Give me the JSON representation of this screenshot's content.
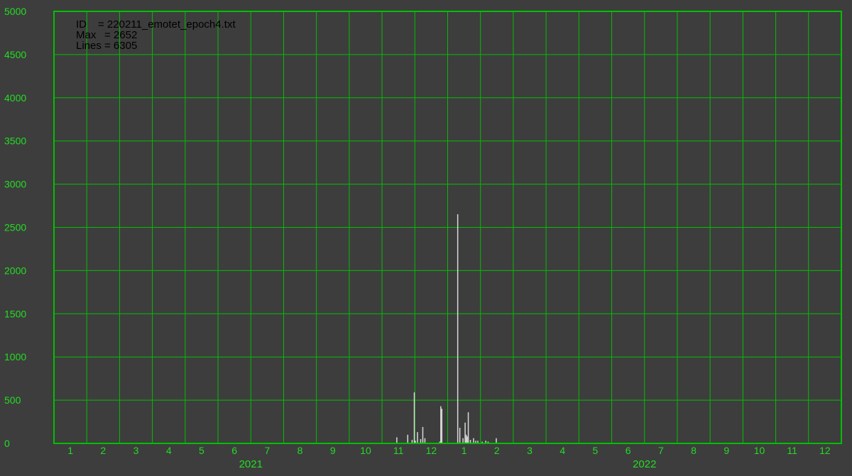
{
  "info": {
    "id_label": "ID",
    "id_value": "= 220211_emotet_epoch4.txt",
    "max_label": "Max",
    "max_value": "= 2652",
    "lines_label": "Lines",
    "lines_value": "= 6305"
  },
  "colors": {
    "background": "#3d3d3d",
    "grid": "#00c000",
    "text": "#22dd22",
    "bars": "#d8d8d8"
  },
  "chart_data": {
    "type": "bar",
    "title": "",
    "xlabel": "",
    "ylabel": "",
    "ylim": [
      0,
      5000
    ],
    "yticks": [
      0,
      500,
      1000,
      1500,
      2000,
      2500,
      3000,
      3500,
      4000,
      4500,
      5000
    ],
    "x_range_months": [
      "2021-01",
      "2022-12"
    ],
    "month_tick_labels": [
      "1",
      "2",
      "3",
      "4",
      "5",
      "6",
      "7",
      "8",
      "9",
      "10",
      "11",
      "12",
      "1",
      "2",
      "3",
      "4",
      "5",
      "6",
      "7",
      "8",
      "9",
      "10",
      "11",
      "12"
    ],
    "year_labels": [
      "2021",
      "2022"
    ],
    "grid": true,
    "series": [
      {
        "points": [
          {
            "date": "2021-11-14",
            "value": 70
          },
          {
            "date": "2021-11-24",
            "value": 100
          },
          {
            "date": "2021-11-28",
            "value": 40
          },
          {
            "date": "2021-11-30",
            "value": 590
          },
          {
            "date": "2021-12-01",
            "value": 30
          },
          {
            "date": "2021-12-03",
            "value": 130
          },
          {
            "date": "2021-12-06",
            "value": 50
          },
          {
            "date": "2021-12-08",
            "value": 190
          },
          {
            "date": "2021-12-10",
            "value": 60
          },
          {
            "date": "2021-12-24",
            "value": 20
          },
          {
            "date": "2021-12-25",
            "value": 430
          },
          {
            "date": "2021-12-26",
            "value": 400
          },
          {
            "date": "2022-01-10",
            "value": 2652
          },
          {
            "date": "2022-01-12",
            "value": 180
          },
          {
            "date": "2022-01-15",
            "value": 60
          },
          {
            "date": "2022-01-17",
            "value": 240
          },
          {
            "date": "2022-01-18",
            "value": 100
          },
          {
            "date": "2022-01-19",
            "value": 80
          },
          {
            "date": "2022-01-20",
            "value": 360
          },
          {
            "date": "2022-01-22",
            "value": 40
          },
          {
            "date": "2022-01-25",
            "value": 60
          },
          {
            "date": "2022-01-27",
            "value": 30
          },
          {
            "date": "2022-01-29",
            "value": 30
          },
          {
            "date": "2022-02-02",
            "value": 20
          },
          {
            "date": "2022-02-05",
            "value": 30
          },
          {
            "date": "2022-02-07",
            "value": 20
          },
          {
            "date": "2022-02-14",
            "value": 60
          }
        ]
      }
    ]
  }
}
